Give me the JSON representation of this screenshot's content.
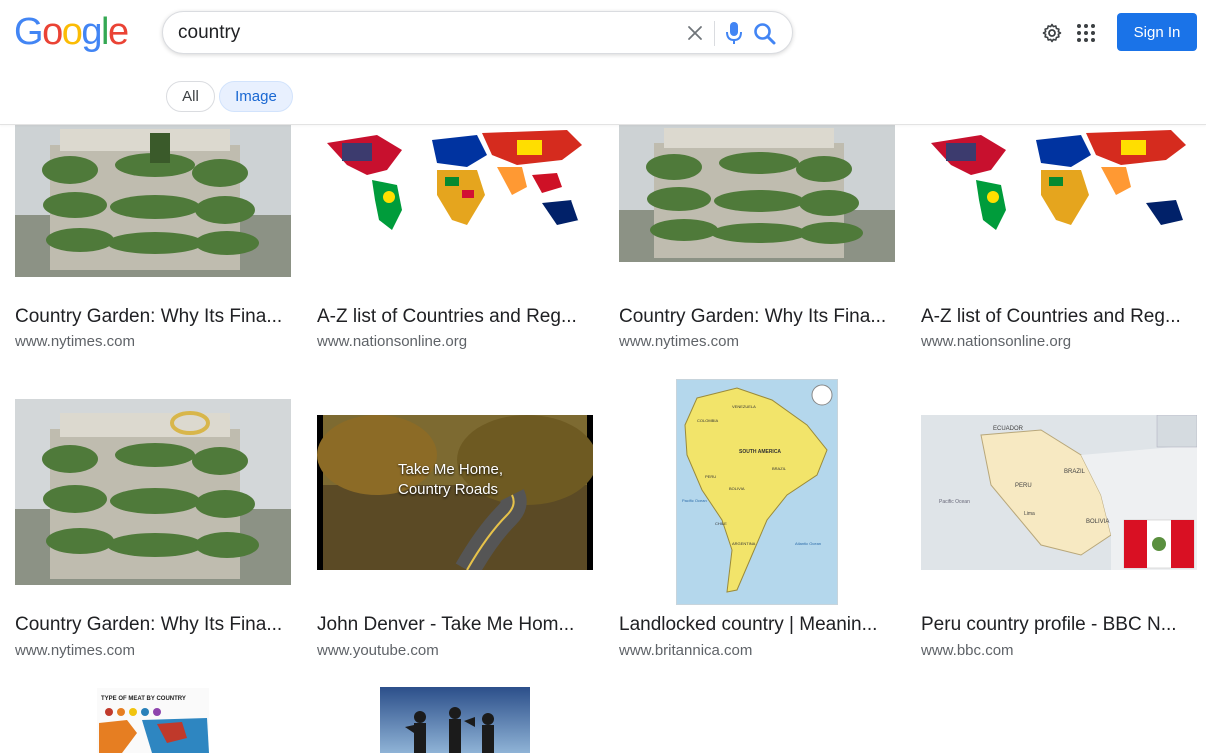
{
  "logo": {
    "letters": [
      "G",
      "o",
      "o",
      "g",
      "l",
      "e"
    ],
    "colors": [
      "#4285f4",
      "#ea4335",
      "#fbbc05",
      "#4285f4",
      "#34a853",
      "#ea4335"
    ]
  },
  "search": {
    "value": "country",
    "placeholder": ""
  },
  "header": {
    "signin_label": "Sign In"
  },
  "tabs": {
    "all_label": "All",
    "image_label": "Image"
  },
  "results": [
    {
      "title": "Country Garden: Why Its Fina...",
      "url": "www.nytimes.com",
      "image": "building"
    },
    {
      "title": "A-Z list of Countries and Reg...",
      "url": "www.nationsonline.org",
      "image": "flag-map"
    },
    {
      "title": "Country Garden: Why Its Fina...",
      "url": "www.nytimes.com",
      "image": "building"
    },
    {
      "title": "A-Z list of Countries and Reg...",
      "url": "www.nationsonline.org",
      "image": "flag-map"
    },
    {
      "title": "Country Garden: Why Its Fina...",
      "url": "www.nytimes.com",
      "image": "building"
    },
    {
      "title": "John Denver - Take Me Hom...",
      "url": "www.youtube.com",
      "image": "video-thumbnail",
      "overlay": "Take Me Home,\nCountry Roads"
    },
    {
      "title": "Landlocked country | Meanin...",
      "url": "www.britannica.com",
      "image": "south-america-map",
      "map_labels": [
        "SOUTH AMERICA",
        "BRAZIL",
        "PERU",
        "BOLIVIA",
        "CHILE",
        "ARGENTINA",
        "COLOMBIA",
        "VENEZUELA",
        "Pacific Ocean",
        "Atlantic Ocean"
      ]
    },
    {
      "title": "Peru country profile - BBC N...",
      "url": "www.bbc.com",
      "image": "peru-map",
      "map_labels": [
        "ECUADOR",
        "PERU",
        "BRAZIL",
        "BOLIVIA",
        "Pacific Ocean",
        "Lima"
      ]
    },
    {
      "title": "",
      "url": "",
      "image": "meat-infographic",
      "image_text": "TYPE OF MEAT BY COUNTRY"
    },
    {
      "title": "",
      "url": "",
      "image": "silhouette-photo"
    }
  ],
  "colors": {
    "accent": "#1a73e8",
    "tab_active_bg": "#e8f0fe",
    "url": "#5f6368"
  },
  "icons": [
    "close-icon",
    "microphone-icon",
    "search-icon",
    "gear-icon",
    "apps-grid-icon"
  ]
}
